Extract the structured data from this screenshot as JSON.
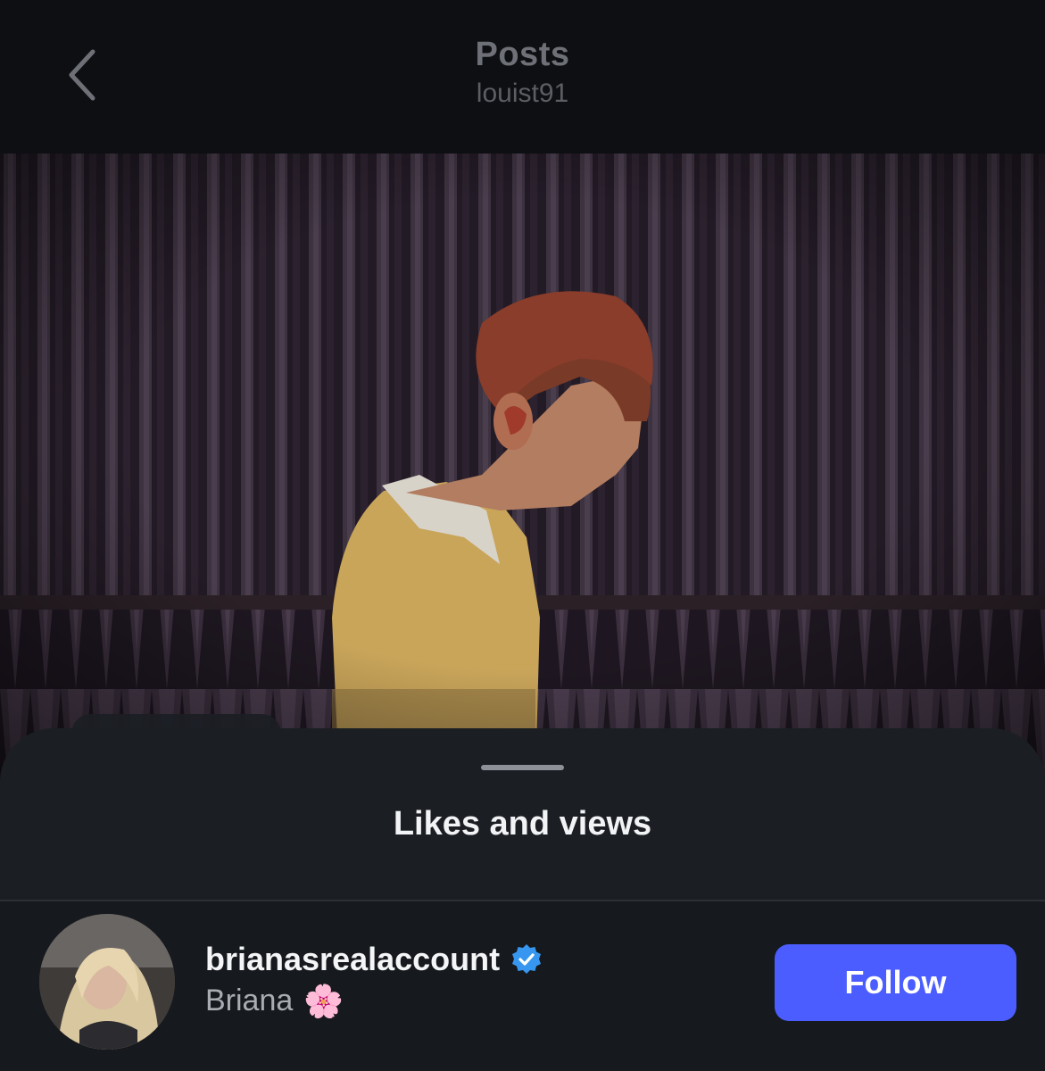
{
  "header": {
    "title": "Posts",
    "subtitle": "louist91",
    "back_icon": "chevron-left-icon"
  },
  "sheet": {
    "title": "Likes and views"
  },
  "user": {
    "username": "brianasrealaccount",
    "verified": true,
    "verified_icon": "verified-badge-icon",
    "display_name": "Briana",
    "name_emoji": "🌸",
    "follow_label": "Follow"
  },
  "colors": {
    "background": "#0c0e11",
    "sheet": "#1b1f24",
    "follow_button": "#4b5dff",
    "verified_blue": "#3797f0",
    "header_text": "#6d7076"
  }
}
